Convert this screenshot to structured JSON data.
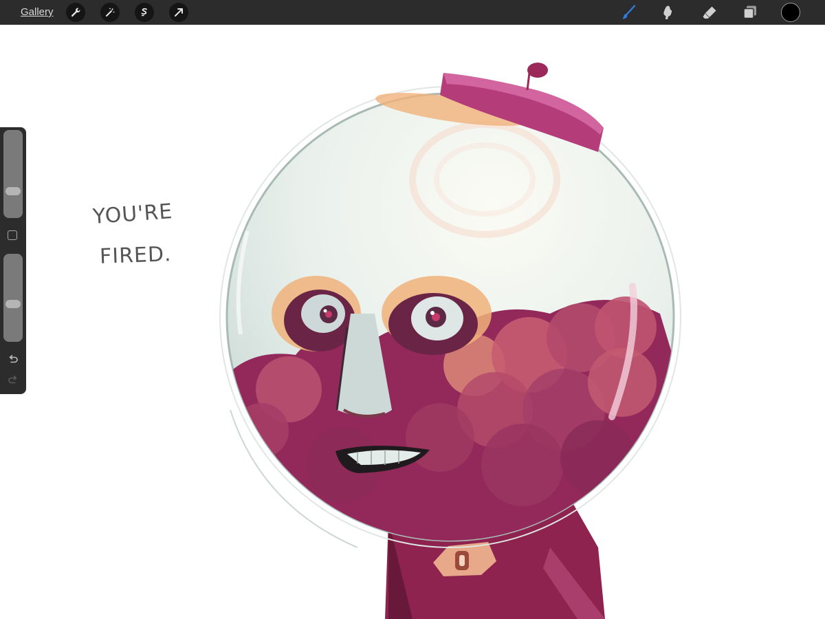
{
  "toolbar": {
    "gallery_label": "Gallery",
    "actions_icon": "wrench-icon",
    "adjustments_icon": "magic-wand-icon",
    "selection_icon": "selection-s-icon",
    "transform_icon": "arrow-icon",
    "brush_icon": "brush-icon",
    "smudge_icon": "smudge-icon",
    "eraser_icon": "eraser-icon",
    "layers_icon": "layers-icon",
    "active_tool": "brush",
    "active_tool_color": "#2f7de1",
    "current_color": "#000000"
  },
  "sidebar": {
    "brush_size_level": 0.27,
    "opacity_level": 0.42,
    "undo_icon": "undo-icon",
    "redo_icon": "redo-icon",
    "modify_icon": "square-icon"
  },
  "canvas": {
    "caption_line1": "YOU'RE",
    "caption_line2": "FIRED.",
    "colors": {
      "gumball_magenta": "#9b2a5a",
      "dark_magenta": "#6a1a3e",
      "glass": "#e7efec",
      "skin_peach": "#f0b27a"
    }
  }
}
